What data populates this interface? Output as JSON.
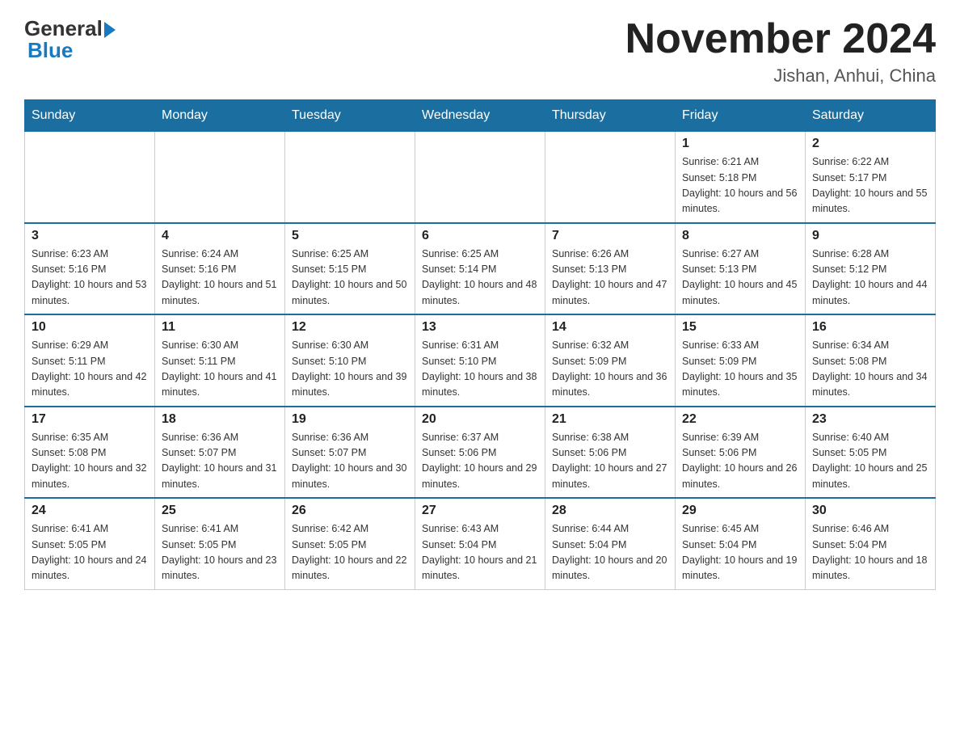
{
  "header": {
    "logo_general": "General",
    "logo_blue": "Blue",
    "month_title": "November 2024",
    "location": "Jishan, Anhui, China"
  },
  "days_of_week": [
    "Sunday",
    "Monday",
    "Tuesday",
    "Wednesday",
    "Thursday",
    "Friday",
    "Saturday"
  ],
  "weeks": [
    [
      {
        "day": "",
        "info": ""
      },
      {
        "day": "",
        "info": ""
      },
      {
        "day": "",
        "info": ""
      },
      {
        "day": "",
        "info": ""
      },
      {
        "day": "",
        "info": ""
      },
      {
        "day": "1",
        "info": "Sunrise: 6:21 AM\nSunset: 5:18 PM\nDaylight: 10 hours and 56 minutes."
      },
      {
        "day": "2",
        "info": "Sunrise: 6:22 AM\nSunset: 5:17 PM\nDaylight: 10 hours and 55 minutes."
      }
    ],
    [
      {
        "day": "3",
        "info": "Sunrise: 6:23 AM\nSunset: 5:16 PM\nDaylight: 10 hours and 53 minutes."
      },
      {
        "day": "4",
        "info": "Sunrise: 6:24 AM\nSunset: 5:16 PM\nDaylight: 10 hours and 51 minutes."
      },
      {
        "day": "5",
        "info": "Sunrise: 6:25 AM\nSunset: 5:15 PM\nDaylight: 10 hours and 50 minutes."
      },
      {
        "day": "6",
        "info": "Sunrise: 6:25 AM\nSunset: 5:14 PM\nDaylight: 10 hours and 48 minutes."
      },
      {
        "day": "7",
        "info": "Sunrise: 6:26 AM\nSunset: 5:13 PM\nDaylight: 10 hours and 47 minutes."
      },
      {
        "day": "8",
        "info": "Sunrise: 6:27 AM\nSunset: 5:13 PM\nDaylight: 10 hours and 45 minutes."
      },
      {
        "day": "9",
        "info": "Sunrise: 6:28 AM\nSunset: 5:12 PM\nDaylight: 10 hours and 44 minutes."
      }
    ],
    [
      {
        "day": "10",
        "info": "Sunrise: 6:29 AM\nSunset: 5:11 PM\nDaylight: 10 hours and 42 minutes."
      },
      {
        "day": "11",
        "info": "Sunrise: 6:30 AM\nSunset: 5:11 PM\nDaylight: 10 hours and 41 minutes."
      },
      {
        "day": "12",
        "info": "Sunrise: 6:30 AM\nSunset: 5:10 PM\nDaylight: 10 hours and 39 minutes."
      },
      {
        "day": "13",
        "info": "Sunrise: 6:31 AM\nSunset: 5:10 PM\nDaylight: 10 hours and 38 minutes."
      },
      {
        "day": "14",
        "info": "Sunrise: 6:32 AM\nSunset: 5:09 PM\nDaylight: 10 hours and 36 minutes."
      },
      {
        "day": "15",
        "info": "Sunrise: 6:33 AM\nSunset: 5:09 PM\nDaylight: 10 hours and 35 minutes."
      },
      {
        "day": "16",
        "info": "Sunrise: 6:34 AM\nSunset: 5:08 PM\nDaylight: 10 hours and 34 minutes."
      }
    ],
    [
      {
        "day": "17",
        "info": "Sunrise: 6:35 AM\nSunset: 5:08 PM\nDaylight: 10 hours and 32 minutes."
      },
      {
        "day": "18",
        "info": "Sunrise: 6:36 AM\nSunset: 5:07 PM\nDaylight: 10 hours and 31 minutes."
      },
      {
        "day": "19",
        "info": "Sunrise: 6:36 AM\nSunset: 5:07 PM\nDaylight: 10 hours and 30 minutes."
      },
      {
        "day": "20",
        "info": "Sunrise: 6:37 AM\nSunset: 5:06 PM\nDaylight: 10 hours and 29 minutes."
      },
      {
        "day": "21",
        "info": "Sunrise: 6:38 AM\nSunset: 5:06 PM\nDaylight: 10 hours and 27 minutes."
      },
      {
        "day": "22",
        "info": "Sunrise: 6:39 AM\nSunset: 5:06 PM\nDaylight: 10 hours and 26 minutes."
      },
      {
        "day": "23",
        "info": "Sunrise: 6:40 AM\nSunset: 5:05 PM\nDaylight: 10 hours and 25 minutes."
      }
    ],
    [
      {
        "day": "24",
        "info": "Sunrise: 6:41 AM\nSunset: 5:05 PM\nDaylight: 10 hours and 24 minutes."
      },
      {
        "day": "25",
        "info": "Sunrise: 6:41 AM\nSunset: 5:05 PM\nDaylight: 10 hours and 23 minutes."
      },
      {
        "day": "26",
        "info": "Sunrise: 6:42 AM\nSunset: 5:05 PM\nDaylight: 10 hours and 22 minutes."
      },
      {
        "day": "27",
        "info": "Sunrise: 6:43 AM\nSunset: 5:04 PM\nDaylight: 10 hours and 21 minutes."
      },
      {
        "day": "28",
        "info": "Sunrise: 6:44 AM\nSunset: 5:04 PM\nDaylight: 10 hours and 20 minutes."
      },
      {
        "day": "29",
        "info": "Sunrise: 6:45 AM\nSunset: 5:04 PM\nDaylight: 10 hours and 19 minutes."
      },
      {
        "day": "30",
        "info": "Sunrise: 6:46 AM\nSunset: 5:04 PM\nDaylight: 10 hours and 18 minutes."
      }
    ]
  ]
}
